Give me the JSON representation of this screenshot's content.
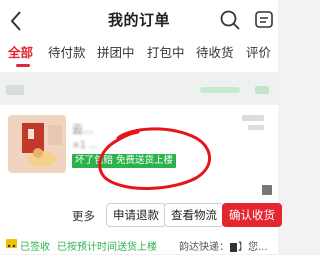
{
  "header": {
    "title": "我的订单"
  },
  "tabs": [
    {
      "label": "全部",
      "active": true
    },
    {
      "label": "待付款"
    },
    {
      "label": "拼团中"
    },
    {
      "label": "打包中"
    },
    {
      "label": "待收货"
    },
    {
      "label": "评价"
    }
  ],
  "order": {
    "product_name": "云...",
    "product_spec": "×1 ...",
    "badges": [
      "坏了包赔",
      "免费送货上楼"
    ],
    "actions": {
      "more": "更多",
      "refund": "申请退款",
      "logistics": "查看物流",
      "confirm": "确认收货"
    },
    "logistics_status": "已签收",
    "logistics_desc": "已按预计时间送货上楼",
    "courier": "韵达快递：",
    "courier_rest": "】您..."
  },
  "colors": {
    "accent": "#e3262f",
    "green": "#2bb24c"
  }
}
